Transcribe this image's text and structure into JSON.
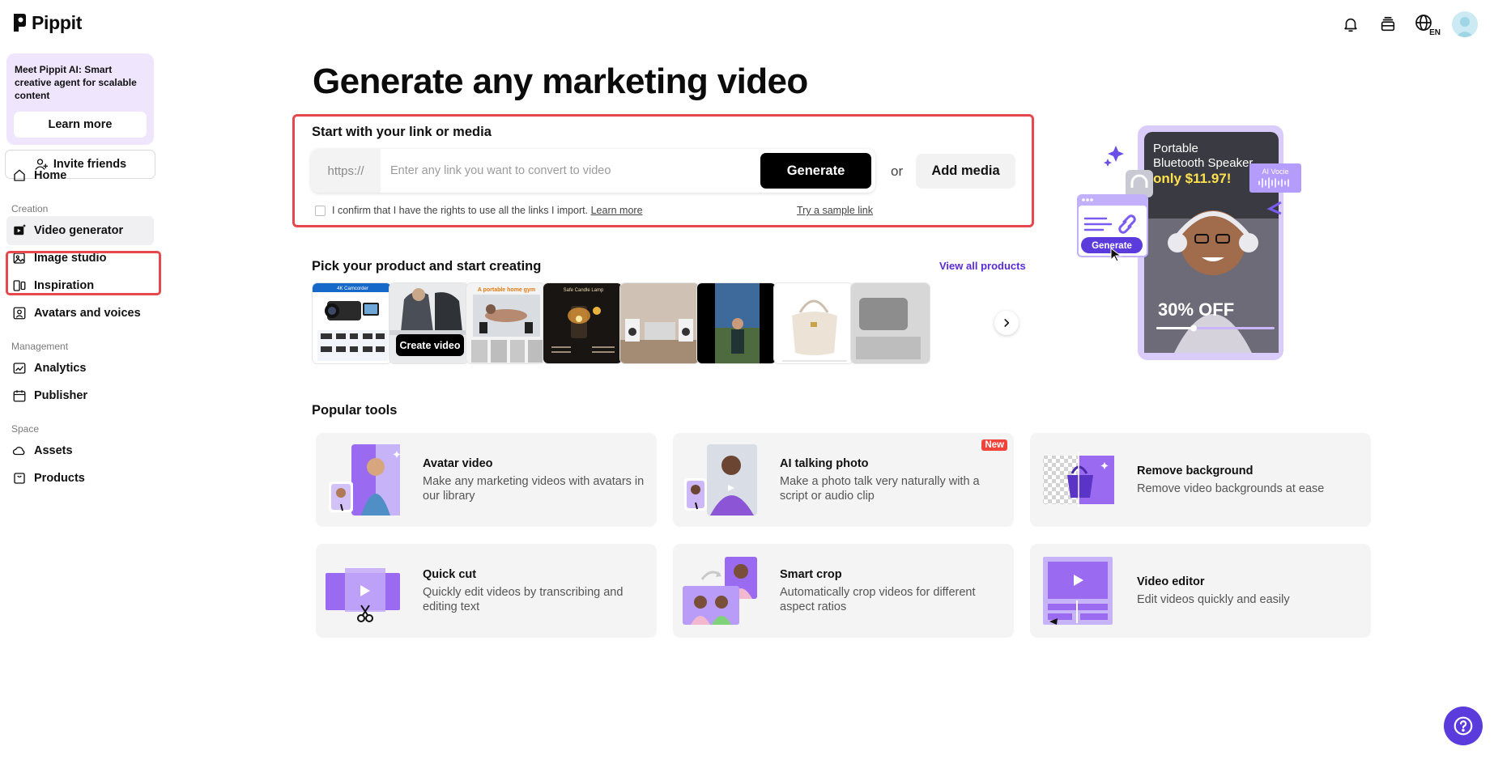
{
  "app": {
    "name": "Pippit"
  },
  "topbar": {
    "icons": [
      "bell-icon",
      "inbox-icon",
      "language-icon",
      "avatar"
    ],
    "language_label": "EN"
  },
  "sidebar": {
    "promo": {
      "text": "Meet Pippit AI: Smart creative agent for scalable content",
      "button": "Learn more"
    },
    "invite": "Invite friends",
    "home": "Home",
    "sections": {
      "creation": "Creation",
      "management": "Management",
      "space": "Space"
    },
    "creation_items": [
      "Video generator",
      "Image studio",
      "Inspiration",
      "Avatars and voices"
    ],
    "management_items": [
      "Analytics",
      "Publisher"
    ],
    "space_items": [
      "Assets",
      "Products"
    ],
    "active_item": "Video generator"
  },
  "hero": {
    "title": "Generate any marketing video",
    "link_heading": "Start with your link or media",
    "url_prefix": "https://",
    "url_placeholder": "Enter any link you want to convert to video",
    "url_value": "",
    "generate_label": "Generate",
    "or_label": "or",
    "add_media_label": "Add media",
    "confirm_text": "I confirm that I have the rights to use all the links I import.",
    "confirm_link": "Learn more",
    "confirm_checked": false,
    "sample_link": "Try a sample link"
  },
  "products": {
    "heading": "Pick your product and start creating",
    "view_all": "View all products",
    "hover_button": "Create video",
    "thumb_texts": [
      "4K Camcorder",
      "A portable home gym",
      "Safe Candle Lamp"
    ]
  },
  "hero_art": {
    "title_line1": "Portable",
    "title_line2": "Bluetooth Speaker",
    "price": "only $11.97!",
    "discount": "30% OFF",
    "voice_tag": "AI Vocie",
    "generate_chip": "Generate"
  },
  "tools": {
    "heading": "Popular tools",
    "items": [
      {
        "title": "Avatar video",
        "desc": "Make any marketing videos with avatars in our library",
        "badge": ""
      },
      {
        "title": "AI talking photo",
        "desc": "Make a photo talk very naturally with a script or audio clip",
        "badge": "New"
      },
      {
        "title": "Remove background",
        "desc": "Remove video backgrounds at ease",
        "badge": ""
      },
      {
        "title": "Quick cut",
        "desc": "Quickly edit videos by transcribing and editing text",
        "badge": ""
      },
      {
        "title": "Smart crop",
        "desc": "Automatically crop videos for different aspect ratios",
        "badge": ""
      },
      {
        "title": "Video editor",
        "desc": "Edit videos quickly and easily",
        "badge": ""
      }
    ]
  },
  "colors": {
    "accent": "#5b3bdc",
    "highlight": "#e5484d",
    "promo_bg": "#efe5fd",
    "card_bg": "#f4f4f5"
  }
}
